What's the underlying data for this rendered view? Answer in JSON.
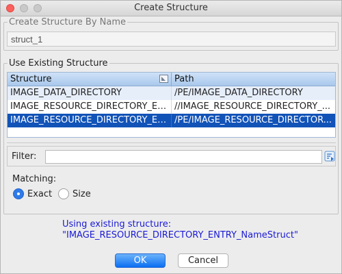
{
  "window": {
    "title": "Create Structure"
  },
  "create_group": {
    "legend": "Create Structure By Name",
    "name_value": "struct_1"
  },
  "existing_group": {
    "legend": "Use Existing Structure",
    "table": {
      "columns": [
        "Structure",
        "Path"
      ],
      "rows": [
        {
          "structure": "IMAGE_DATA_DIRECTORY",
          "path": "/PE/IMAGE_DATA_DIRECTORY"
        },
        {
          "structure": "IMAGE_RESOURCE_DIRECTORY_EN...",
          "path": "//IMAGE_RESOURCE_DIRECTORY_..."
        },
        {
          "structure": "IMAGE_RESOURCE_DIRECTORY_EN...",
          "path": "/PE/IMAGE_RESOURCE_DIRECTOR..."
        }
      ],
      "selected_row": 2
    },
    "filter": {
      "label": "Filter:",
      "value": ""
    },
    "matching": {
      "label": "Matching:",
      "options": [
        "Exact",
        "Size"
      ],
      "selected": "Exact"
    }
  },
  "status": {
    "line1": "Using existing structure:",
    "line2": "\"IMAGE_RESOURCE_DIRECTORY_ENTRY_NameStruct\""
  },
  "buttons": {
    "ok": "OK",
    "cancel": "Cancel"
  },
  "colors": {
    "accent": "#0a6ef2",
    "selection": "#1253b8",
    "status_text": "#1a1ad6"
  }
}
